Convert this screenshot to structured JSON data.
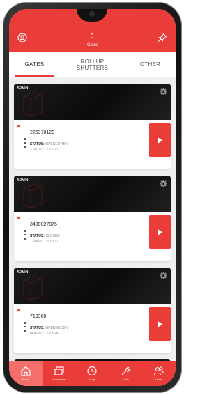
{
  "header": {
    "title": "Gates"
  },
  "tabs": [
    {
      "label": "GATES",
      "active": true
    },
    {
      "label": "ROLLUP SHUTTERS",
      "active": false
    },
    {
      "label": "OTHER",
      "active": false
    }
  ],
  "cards": [
    {
      "role": "ADMIN",
      "gate_id": "226370120",
      "status_label": "STATUS:",
      "status_value": "OPENED 45%",
      "datetime": "21/01/22 - h 12:21"
    },
    {
      "role": "ADMIN",
      "gate_id": "3430027875",
      "status_label": "STATUS:",
      "status_value": "CLOSED",
      "datetime": "12/04/22 - h 13:31"
    },
    {
      "role": "ADMIN",
      "gate_id": "719360",
      "status_label": "STATUS:",
      "status_value": "OPENED 30%",
      "datetime": "04/03/22 - h 13:26"
    }
  ],
  "bottom_nav": [
    {
      "label": "Home",
      "icon": "home-icon",
      "active": true
    },
    {
      "label": "Scenarios",
      "icon": "layers-icon",
      "active": false
    },
    {
      "label": "Logs",
      "icon": "clock-icon",
      "active": false
    },
    {
      "label": "Tools",
      "icon": "wrench-icon",
      "active": false
    },
    {
      "label": "Users",
      "icon": "users-icon",
      "active": false
    }
  ],
  "colors": {
    "accent": "#ea3c39",
    "banner": "#111111",
    "background": "#efefef"
  }
}
